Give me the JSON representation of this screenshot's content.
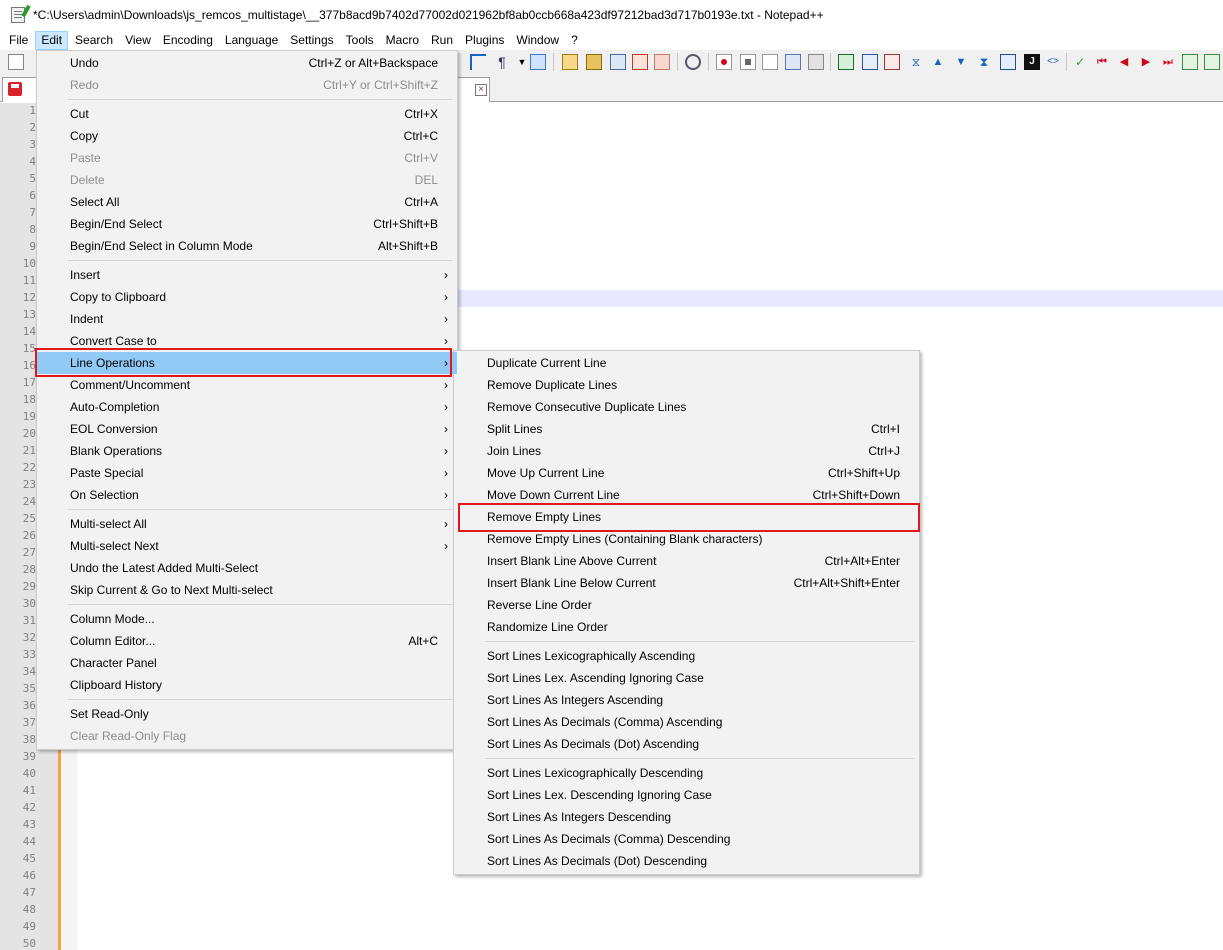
{
  "window": {
    "title": "*C:\\Users\\admin\\Downloads\\js_remcos_multistage\\__377b8acd9b7402d77002d021962bf8ab0ccb668a423df97212bad3d717b0193e.txt - Notepad++"
  },
  "menubar": {
    "items": [
      "File",
      "Edit",
      "Search",
      "View",
      "Encoding",
      "Language",
      "Settings",
      "Tools",
      "Macro",
      "Run",
      "Plugins",
      "Window",
      "?"
    ],
    "active": "Edit"
  },
  "tab": {
    "close_glyph": "×"
  },
  "line_numbers": [
    "1",
    "2",
    "3",
    "4",
    "5",
    "6",
    "7",
    "8",
    "9",
    "10",
    "11",
    "12",
    "13",
    "14",
    "15",
    "16",
    "17",
    "18",
    "19",
    "20",
    "21",
    "22",
    "23",
    "24",
    "25",
    "26",
    "27",
    "28",
    "29",
    "30",
    "31",
    "32",
    "33",
    "34",
    "35",
    "36",
    "37",
    "38",
    "39",
    "40",
    "41",
    "42",
    "43",
    "44",
    "45",
    "46",
    "47",
    "48",
    "49",
    "50"
  ],
  "edit_menu": {
    "submenu_arrow": "›",
    "items": [
      {
        "label": "Undo",
        "shortcut": "Ctrl+Z or Alt+Backspace",
        "enabled": true
      },
      {
        "label": "Redo",
        "shortcut": "Ctrl+Y or Ctrl+Shift+Z",
        "enabled": false
      },
      {
        "label": "Cut",
        "shortcut": "Ctrl+X",
        "enabled": true
      },
      {
        "label": "Copy",
        "shortcut": "Ctrl+C",
        "enabled": true
      },
      {
        "label": "Paste",
        "shortcut": "Ctrl+V",
        "enabled": false
      },
      {
        "label": "Delete",
        "shortcut": "DEL",
        "enabled": false
      },
      {
        "label": "Select All",
        "shortcut": "Ctrl+A",
        "enabled": true
      },
      {
        "label": "Begin/End Select",
        "shortcut": "Ctrl+Shift+B",
        "enabled": true
      },
      {
        "label": "Begin/End Select in Column Mode",
        "shortcut": "Alt+Shift+B",
        "enabled": true
      },
      {
        "label": "Insert",
        "submenu": true
      },
      {
        "label": "Copy to Clipboard",
        "submenu": true
      },
      {
        "label": "Indent",
        "submenu": true
      },
      {
        "label": "Convert Case to",
        "submenu": true
      },
      {
        "label": "Line Operations",
        "submenu": true,
        "highlighted": true
      },
      {
        "label": "Comment/Uncomment",
        "submenu": true
      },
      {
        "label": "Auto-Completion",
        "submenu": true
      },
      {
        "label": "EOL Conversion",
        "submenu": true
      },
      {
        "label": "Blank Operations",
        "submenu": true
      },
      {
        "label": "Paste Special",
        "submenu": true
      },
      {
        "label": "On Selection",
        "submenu": true
      },
      {
        "label": "Multi-select All",
        "submenu": true
      },
      {
        "label": "Multi-select Next",
        "submenu": true
      },
      {
        "label": "Undo the Latest Added Multi-Select"
      },
      {
        "label": "Skip Current & Go to Next Multi-select"
      },
      {
        "label": "Column Mode..."
      },
      {
        "label": "Column Editor...",
        "shortcut": "Alt+C"
      },
      {
        "label": "Character Panel"
      },
      {
        "label": "Clipboard History"
      },
      {
        "label": "Set Read-Only"
      },
      {
        "label": "Clear Read-Only Flag",
        "enabled": false
      }
    ]
  },
  "line_ops_menu": {
    "items": [
      {
        "label": "Duplicate Current Line"
      },
      {
        "label": "Remove Duplicate Lines"
      },
      {
        "label": "Remove Consecutive Duplicate Lines"
      },
      {
        "label": "Split Lines",
        "shortcut": "Ctrl+I"
      },
      {
        "label": "Join Lines",
        "shortcut": "Ctrl+J"
      },
      {
        "label": "Move Up Current Line",
        "shortcut": "Ctrl+Shift+Up"
      },
      {
        "label": "Move Down Current Line",
        "shortcut": "Ctrl+Shift+Down"
      },
      {
        "label": "Remove Empty Lines",
        "outlined": true
      },
      {
        "label": "Remove Empty Lines (Containing Blank characters)"
      },
      {
        "label": "Insert Blank Line Above Current",
        "shortcut": "Ctrl+Alt+Enter"
      },
      {
        "label": "Insert Blank Line Below Current",
        "shortcut": "Ctrl+Alt+Shift+Enter"
      },
      {
        "label": "Reverse Line Order"
      },
      {
        "label": "Randomize Line Order"
      },
      {
        "label": "Sort Lines Lexicographically Ascending"
      },
      {
        "label": "Sort Lines Lex. Ascending Ignoring Case"
      },
      {
        "label": "Sort Lines As Integers Ascending"
      },
      {
        "label": "Sort Lines As Decimals (Comma) Ascending"
      },
      {
        "label": "Sort Lines As Decimals (Dot) Ascending"
      },
      {
        "label": "Sort Lines Lexicographically Descending"
      },
      {
        "label": "Sort Lines Lex. Descending Ignoring Case"
      },
      {
        "label": "Sort Lines As Integers Descending"
      },
      {
        "label": "Sort Lines As Decimals (Comma) Descending"
      },
      {
        "label": "Sort Lines As Decimals (Dot) Descending"
      }
    ]
  },
  "colors": {
    "menu_bg": "#f2f2f2",
    "menu_highlight": "#91c9f7",
    "annotation_red": "#e0191f",
    "gutter_accent": "#f2a44a",
    "current_line": "#e8e8ff"
  }
}
